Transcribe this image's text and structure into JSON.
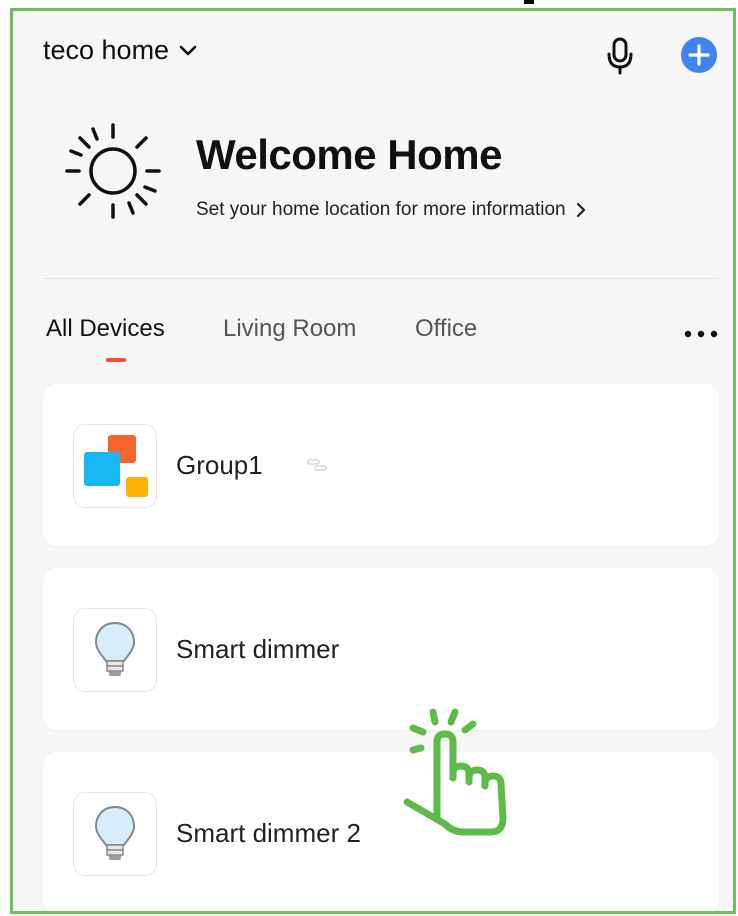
{
  "header": {
    "home_name": "teco home",
    "home_dropdown_icon": "chevron-down-icon",
    "mic_icon": "microphone-icon",
    "add_icon": "plus-icon"
  },
  "welcome": {
    "title": "Welcome Home",
    "subtitle": "Set your home location for more information",
    "weather_icon": "sun-icon",
    "subtitle_icon": "chevron-right-icon"
  },
  "tabs": [
    {
      "label": "All Devices",
      "active": true
    },
    {
      "label": "Living Room",
      "active": false
    },
    {
      "label": "Office",
      "active": false
    }
  ],
  "tabs_more_icon": "more-horizontal-icon",
  "devices": [
    {
      "name": "Group1",
      "icon": "group-icon",
      "badge_icon": "link-icon"
    },
    {
      "name": "Smart dimmer",
      "icon": "lightbulb-icon"
    },
    {
      "name": "Smart dimmer 2",
      "icon": "lightbulb-icon"
    }
  ],
  "overlay": {
    "icon": "tap-hand-icon"
  },
  "colors": {
    "accent": "#3f83ef",
    "tab_indicator": "#f0503a",
    "frame_border": "#6cc05b",
    "background": "#f6f6f6",
    "card": "#ffffff"
  }
}
